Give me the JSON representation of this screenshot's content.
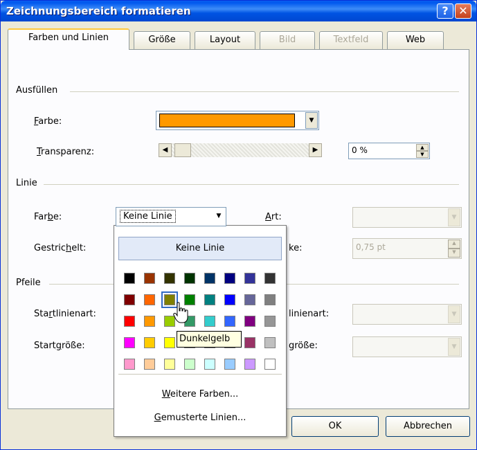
{
  "window": {
    "title": "Zeichnungsbereich formatieren"
  },
  "tabs": [
    {
      "label": "Farben und Linien",
      "state": "active"
    },
    {
      "label": "Größe",
      "state": "normal"
    },
    {
      "label": "Layout",
      "state": "normal"
    },
    {
      "label": "Bild",
      "state": "disabled"
    },
    {
      "label": "Textfeld",
      "state": "disabled"
    },
    {
      "label": "Web",
      "state": "normal"
    }
  ],
  "fill": {
    "section_label": "Ausfüllen",
    "color_label_u": "F",
    "color_label_rest": "arbe:",
    "color_value": "#ff9900",
    "transparency_label_u": "T",
    "transparency_label_rest": "ransparenz:",
    "transparency_value": "0 %"
  },
  "line": {
    "section_label": "Linie",
    "color_label_pre": "Far",
    "color_label_u": "b",
    "color_label_post": "e:",
    "color_value": "Keine Linie",
    "dashed_label_pre": "Gestric",
    "dashed_label_u": "h",
    "dashed_label_post": "elt:",
    "style_label_u": "A",
    "style_label_rest": "rt:",
    "weight_label_partial": "ke:",
    "weight_value": "0,75 pt"
  },
  "arrows": {
    "section_label": "Pfeile",
    "start_type_pre": "Sta",
    "start_type_u": "r",
    "start_type_post": "tlinienart:",
    "start_size_pre": "Start",
    "start_size_u": "g",
    "start_size_post": "röße:",
    "end_type_partial": "linienart:",
    "end_size_partial": "größe:"
  },
  "popup": {
    "no_line": "Keine Linie",
    "more_colors_u": "W",
    "more_colors_rest": "eitere Farben...",
    "patterned_u": "G",
    "patterned_rest": "emusterte Linien...",
    "selected_color": "Dunkelgelb",
    "colors": [
      [
        "#000000",
        "#993300",
        "#333300",
        "#003300",
        "#003366",
        "#000080",
        "#333399",
        "#333333"
      ],
      [
        "#800000",
        "#ff6600",
        "#808000",
        "#008000",
        "#008080",
        "#0000ff",
        "#666699",
        "#808080"
      ],
      [
        "#ff0000",
        "#ff9900",
        "#99cc00",
        "#339966",
        "#33cccc",
        "#3366ff",
        "#800080",
        "#969696"
      ],
      [
        "#ff00ff",
        "#ffcc00",
        "#ffff00",
        "#00ff00",
        "#00ffff",
        "#00ccff",
        "#993366",
        "#c0c0c0"
      ],
      [
        "#ff99cc",
        "#ffcc99",
        "#ffff99",
        "#ccffcc",
        "#ccffff",
        "#99ccff",
        "#cc99ff",
        "#ffffff"
      ]
    ]
  },
  "tooltip": "Dunkelgelb",
  "buttons": {
    "ok": "OK",
    "cancel": "Abbrechen"
  }
}
